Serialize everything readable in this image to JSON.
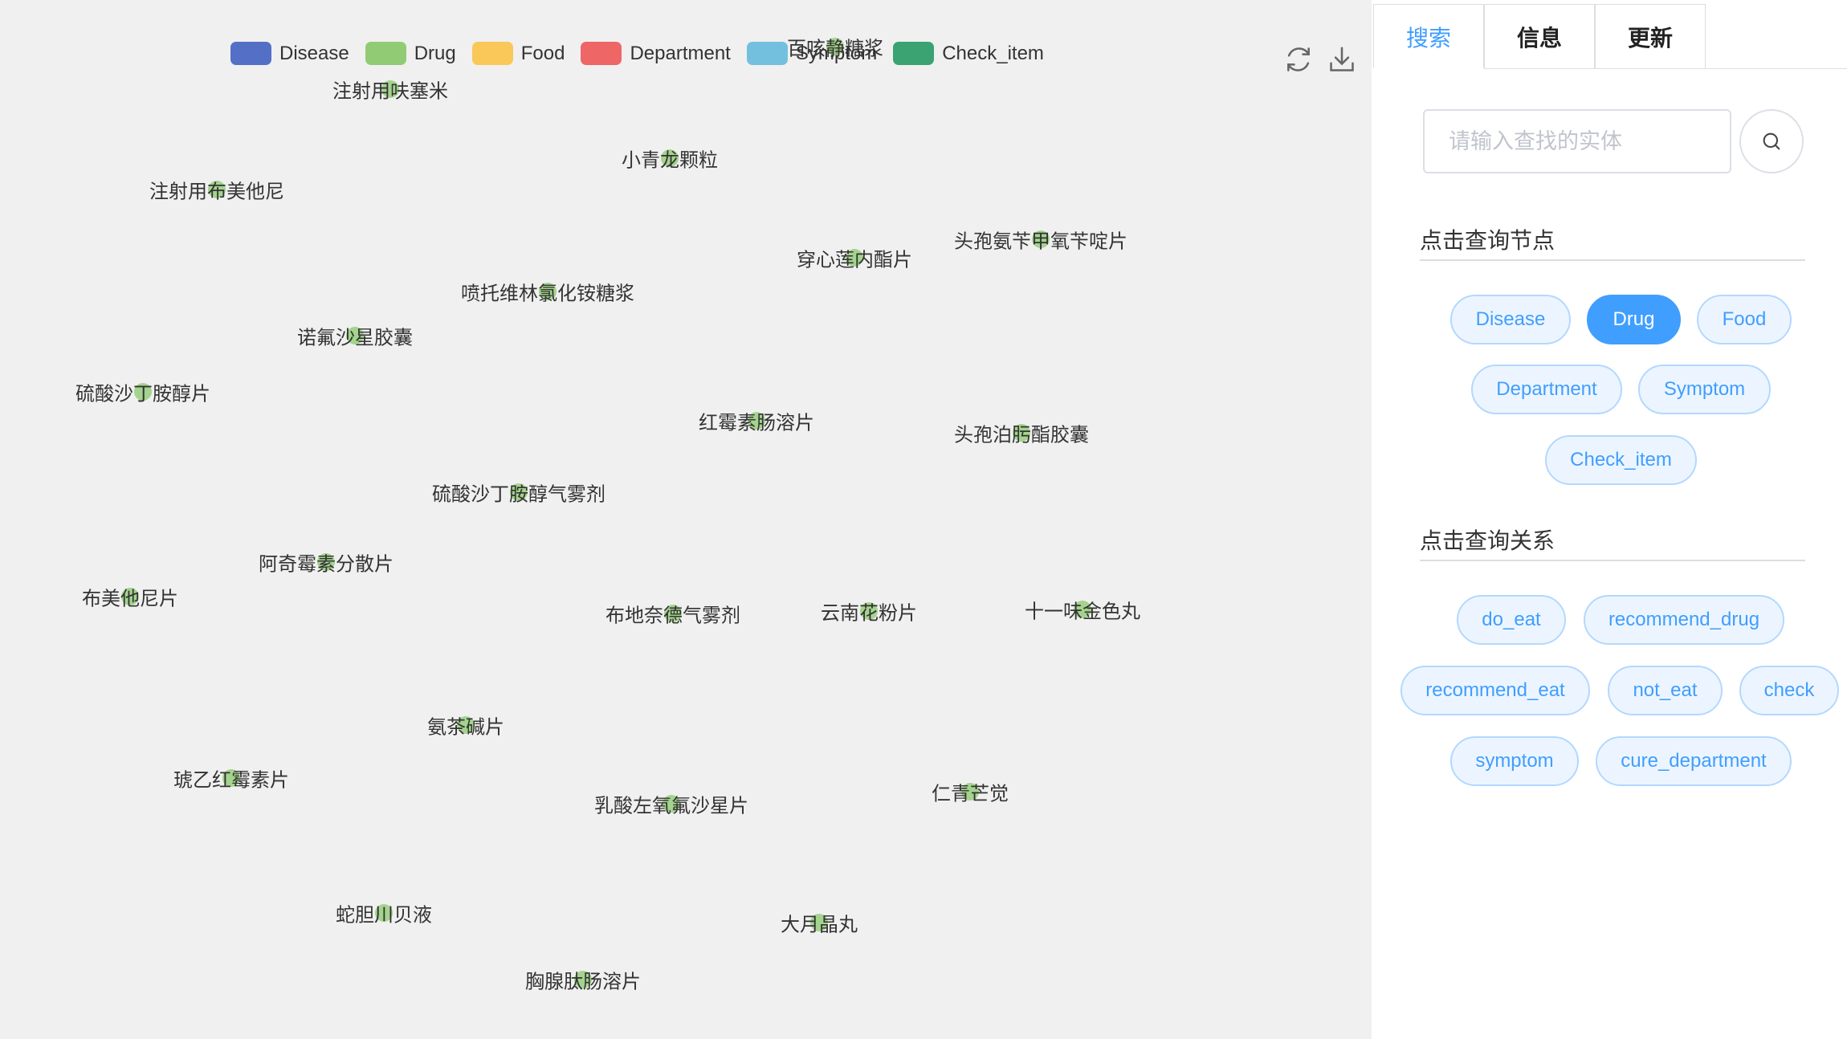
{
  "legend": [
    {
      "label": "Disease",
      "color": "#5470c6"
    },
    {
      "label": "Drug",
      "color": "#91cc75"
    },
    {
      "label": "Food",
      "color": "#fac858"
    },
    {
      "label": "Department",
      "color": "#ee6666"
    },
    {
      "label": "Symptom",
      "color": "#73c0de"
    },
    {
      "label": "Check_item",
      "color": "#3ba272"
    }
  ],
  "toolbar": {
    "refresh_icon": "refresh-icon",
    "download_icon": "download-icon"
  },
  "nodes": [
    "百咳静糖浆",
    "注射用呋塞米",
    "小青龙颗粒",
    "注射用布美他尼",
    "头孢氨苄甲氧苄啶片",
    "穿心莲内酯片",
    "喷托维林氯化铵糖浆",
    "诺氟沙星胶囊",
    "硫酸沙丁胺醇片",
    "红霉素肠溶片",
    "头孢泊肟酯胶囊",
    "硫酸沙丁胺醇气雾剂",
    "阿奇霉素分散片",
    "布美他尼片",
    "布地奈德气雾剂",
    "云南花粉片",
    "十一味金色丸",
    "氨茶碱片",
    "琥乙红霉素片",
    "乳酸左氧氟沙星片",
    "仁青芒觉",
    "蛇胆川贝液",
    "大月晶丸",
    "胸腺肽肠溶片"
  ],
  "tabs": [
    "搜索",
    "信息",
    "更新"
  ],
  "search": {
    "placeholder": "请输入查找的实体",
    "icon": "search-icon"
  },
  "node_section": {
    "title": "点击查询节点",
    "items": [
      "Disease",
      "Drug",
      "Food",
      "Department",
      "Symptom",
      "Check_item"
    ],
    "selected": "Drug"
  },
  "relation_section": {
    "title": "点击查询关系",
    "items": [
      "do_eat",
      "recommend_drug",
      "recommend_eat",
      "not_eat",
      "check",
      "symptom",
      "cure_department"
    ]
  }
}
